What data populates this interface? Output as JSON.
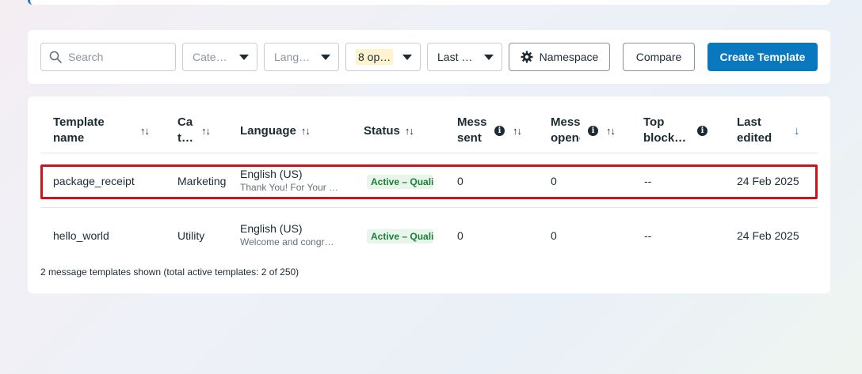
{
  "filters": {
    "search_placeholder": "Search",
    "category_placeholder": "Cate…",
    "language_placeholder": "Lang…",
    "status_value": "8 op…",
    "last_edited_placeholder": "Last …",
    "namespace_label": "Namespace",
    "compare_label": "Compare",
    "create_label": "Create Template"
  },
  "table": {
    "headers": {
      "name_line1": "Template",
      "name_line2": "name",
      "category_line1": "Ca",
      "category_line2": "t…",
      "language": "Language",
      "status": "Status",
      "sent_line1": "Mess",
      "sent_line2": "sent",
      "opened_line1": "Mess",
      "opened_line2": "opene",
      "top_block_line1": "Top",
      "top_block_line2": "block…",
      "last_edited_line1": "Last",
      "last_edited_line2": "edited"
    },
    "sort_icon": "↑↓",
    "sort_active_icon": "↓",
    "rows": [
      {
        "name": "package_receipt",
        "category": "Marketing",
        "language": "English (US)",
        "preview": "Thank You! For Your …",
        "status": "Active – Quali",
        "sent": "0",
        "opened": "0",
        "top_block": "--",
        "last_edited": "24 Feb 2025"
      },
      {
        "name": "hello_world",
        "category": "Utility",
        "language": "English (US)",
        "preview": "Welcome and congr…",
        "status": "Active – Quali",
        "sent": "0",
        "opened": "0",
        "top_block": "--",
        "last_edited": "24 Feb 2025"
      }
    ],
    "footer": "2 message templates shown (total active templates: 2 of 250)"
  },
  "colors": {
    "primary": "#0a78be",
    "selection": "#d0121b",
    "status_green": "#1e7d3c",
    "highlight": "#fff3cf"
  },
  "icons": {
    "search": "search-icon",
    "caret": "caret-down-icon",
    "gear": "gear-icon",
    "info": "info-icon"
  }
}
